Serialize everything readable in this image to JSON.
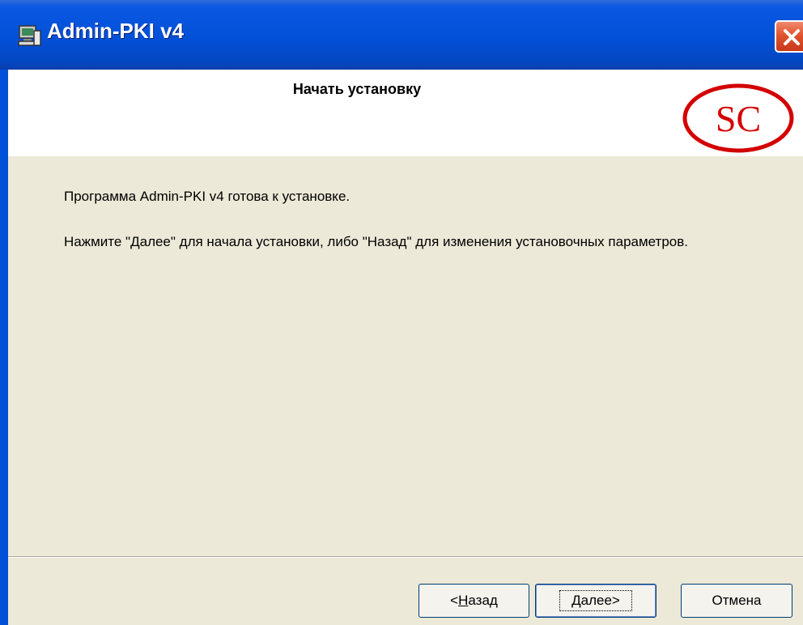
{
  "window": {
    "title": "Admin-PKI v4",
    "icon": "installer-computer-icon",
    "close_icon": "close-icon"
  },
  "header": {
    "title": "Начать установку",
    "logo_text": "SC",
    "logo_color": "#d40000"
  },
  "body": {
    "ready_message": "Программа Admin-PKI v4 готова к установке.",
    "instruction": "Нажмите \"Далее\" для начала установки, либо \"Назад\" для изменения установочных параметров."
  },
  "buttons": {
    "back_prefix": "<",
    "back_mnemonic": "Н",
    "back_rest": "азад",
    "next_mnemonic": "Д",
    "next_rest": "алее>",
    "cancel": "Отмена"
  }
}
